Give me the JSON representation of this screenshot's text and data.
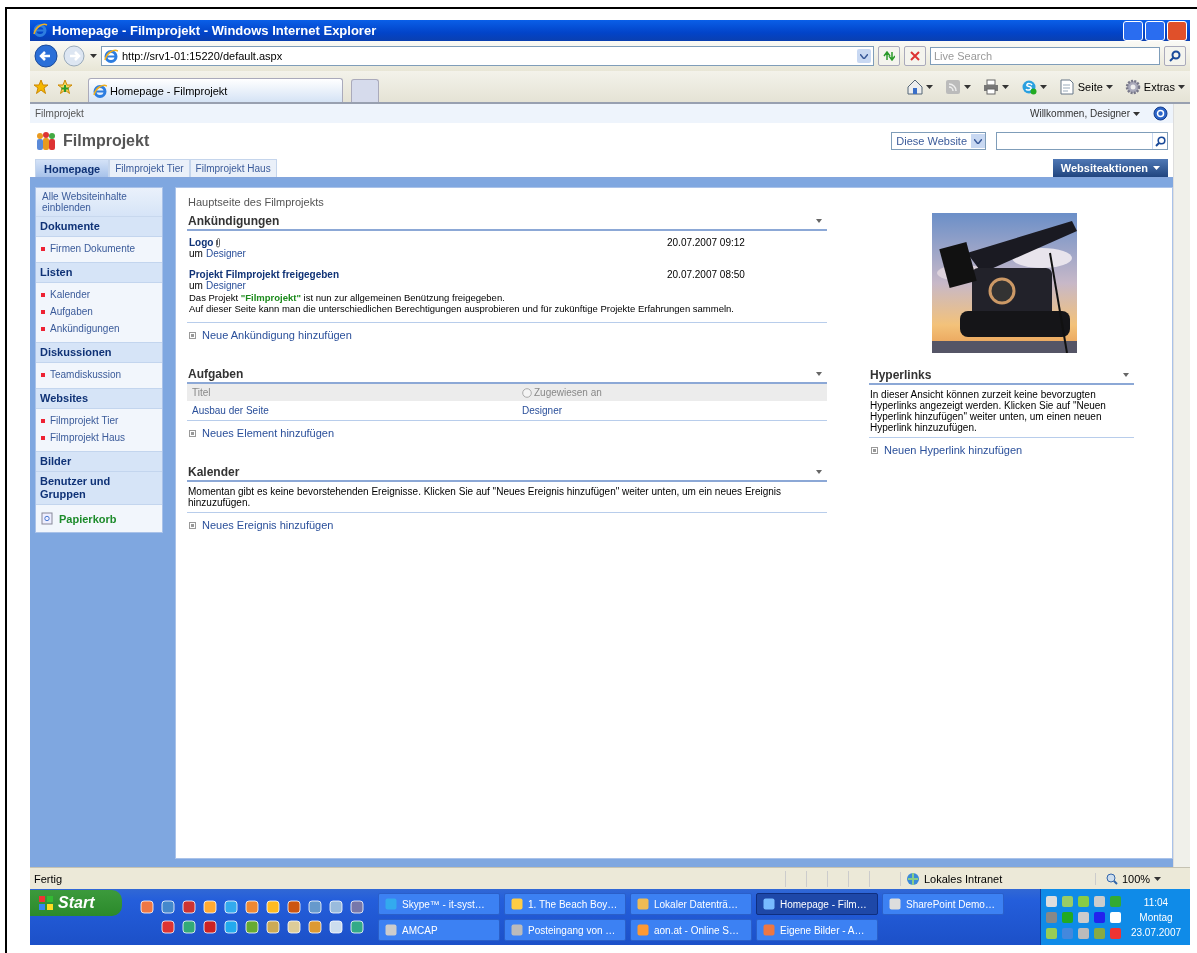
{
  "window": {
    "title": "Homepage - Filmprojekt - Windows Internet Explorer"
  },
  "address_bar": {
    "url": "http://srv1-01:15220/default.aspx"
  },
  "search": {
    "placeholder": "Live Search"
  },
  "tabs": [
    {
      "label": "Homepage - Filmprojekt",
      "selected": true
    }
  ],
  "command_bar": [
    {
      "kind": "home"
    },
    {
      "kind": "feed"
    },
    {
      "kind": "print"
    },
    {
      "kind": "skype"
    },
    {
      "kind": "page",
      "label": "Seite"
    },
    {
      "kind": "tools",
      "label": "Extras"
    }
  ],
  "site": {
    "breadcrumb": "Filmprojekt",
    "welcome": "Willkommen, Designer",
    "title": "Filmprojekt",
    "search_scope": "Diese Website",
    "nav_tabs": [
      {
        "label": "Homepage",
        "selected": true
      },
      {
        "label": "Filmprojekt Tier",
        "selected": false
      },
      {
        "label": "Filmprojekt Haus",
        "selected": false
      }
    ],
    "site_actions": "Websiteaktionen"
  },
  "quick_launch": {
    "view_all": "Alle Websiteinhalte einblenden",
    "sections": [
      {
        "title": "Dokumente",
        "items": [
          "Firmen Dokumente"
        ]
      },
      {
        "title": "Listen",
        "items": [
          "Kalender",
          "Aufgaben",
          "Ankündigungen"
        ]
      },
      {
        "title": "Diskussionen",
        "items": [
          "Teamdiskussion"
        ]
      },
      {
        "title": "Websites",
        "items": [
          "Filmprojekt Tier",
          "Filmprojekt Haus"
        ]
      },
      {
        "title": "Bilder"
      },
      {
        "title": "Benutzer und Gruppen"
      }
    ],
    "recycle_bin": "Papierkorb"
  },
  "page_title": "Hauptseite des Filmprojekts",
  "announcements": {
    "title": "Ankündigungen",
    "items": [
      {
        "title": "Logo",
        "attachment": true,
        "by": "um",
        "author": "Designer",
        "date": "20.07.2007 09:12"
      },
      {
        "title": "Projekt Filmprojekt freigegeben",
        "attachment": false,
        "by": "um",
        "author": "Designer",
        "date": "20.07.2007 08:50",
        "body": [
          "Das Projekt **\"Filmprojekt\"** ist nun zur allgemeinen Benützung freigegeben.",
          "Auf dieser Seite kann man die unterschiedlichen Berechtigungen ausprobieren und für zukünftige Projekte Erfahrungen sammeln."
        ]
      }
    ],
    "add_link": "Neue Ankündigung hinzufügen"
  },
  "tasks": {
    "title": "Aufgaben",
    "columns": [
      "Titel",
      "Zugewiesen an"
    ],
    "rows": [
      [
        "Ausbau der Seite",
        "Designer"
      ]
    ],
    "add_link": "Neues Element hinzufügen"
  },
  "calendar": {
    "title": "Kalender",
    "message": "Momentan gibt es keine bevorstehenden Ereignisse. Klicken Sie auf \"Neues Ereignis hinzufügen\" weiter unten, um ein neues Ereignis hinzuzufügen.",
    "add_link": "Neues Ereignis hinzufügen"
  },
  "hyperlinks": {
    "title": "Hyperlinks",
    "message": "In dieser Ansicht können zurzeit keine bevorzugten Hyperlinks angezeigt werden. Klicken Sie auf \"Neuen Hyperlink hinzufügen\" weiter unten, um einen neuen Hyperlink hinzuzufügen.",
    "add_link": "Neuen Hyperlink hinzufügen"
  },
  "status_bar": {
    "text": "Fertig",
    "zone": "Lokales Intranet",
    "zoom": "100%"
  },
  "taskbar": {
    "start": "Start",
    "buttons": [
      {
        "label": "Skype™ - it-syst…",
        "active": false
      },
      {
        "label": "1. The Beach Boy…",
        "active": false
      },
      {
        "label": "Lokaler Datenträ…",
        "active": false
      },
      {
        "label": "Homepage - Film…",
        "active": true
      },
      {
        "label": "SharePoint Demo…",
        "active": false
      },
      {
        "label": "AMCAP",
        "active": false
      },
      {
        "label": "Posteingang von …",
        "active": false
      },
      {
        "label": "aon.at - Online S…",
        "active": false
      },
      {
        "label": "Eigene Bilder - A…",
        "active": false
      }
    ],
    "clock": {
      "time": "11:04",
      "day": "Montag",
      "date": "23.07.2007"
    }
  }
}
